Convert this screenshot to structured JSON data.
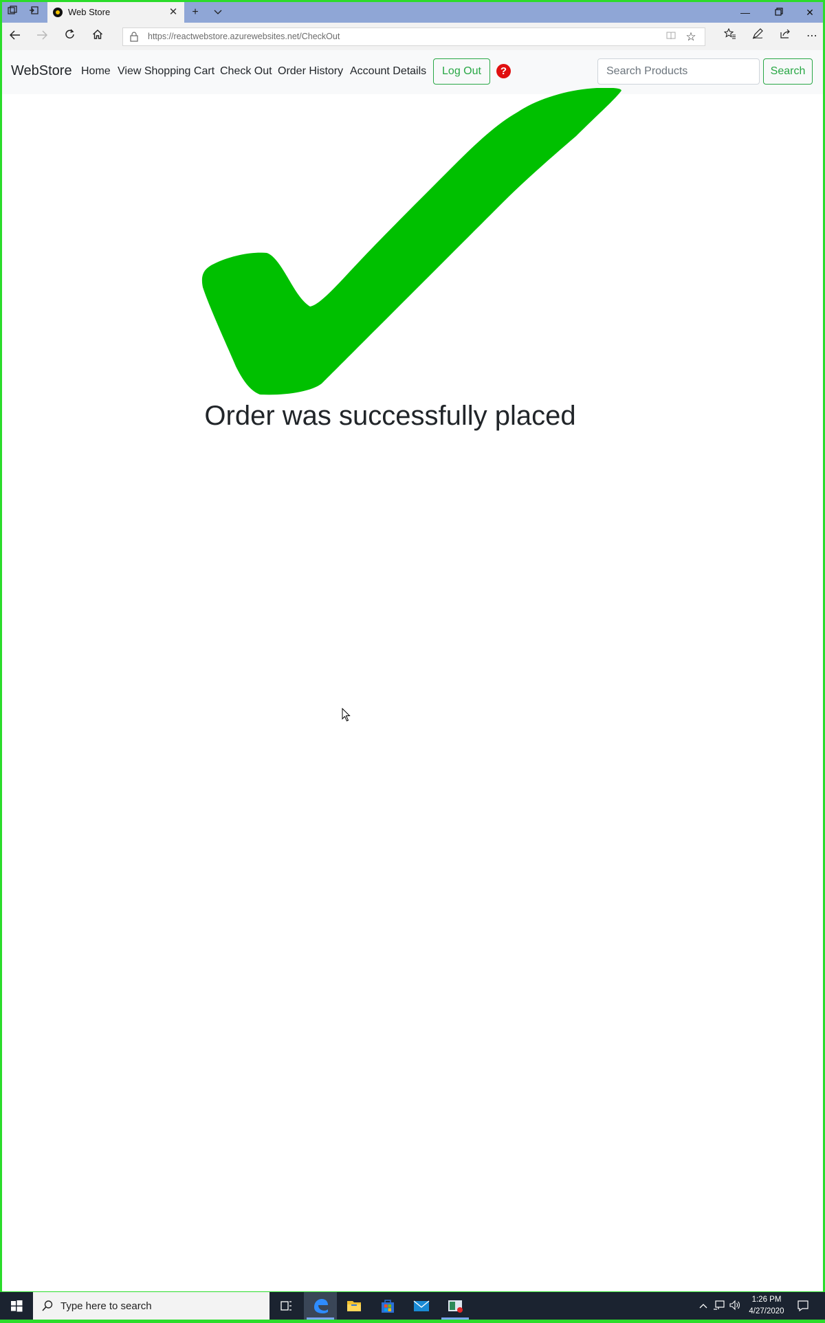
{
  "browser": {
    "tab_title": "Web Store",
    "url_host": "https://reactwebstore.azurewebsites.net",
    "url_path": "/CheckOut"
  },
  "site_nav": {
    "brand": "WebStore",
    "links": [
      "Home",
      "View Shopping Cart",
      "Check Out",
      "Order History",
      "Account Details"
    ],
    "logout_label": "Log Out",
    "help_label": "?",
    "search_placeholder": "Search Products",
    "search_button_label": "Search"
  },
  "content": {
    "success_message": "Order was successfully placed",
    "checkmark_color": "#00c000"
  },
  "taskbar": {
    "search_placeholder": "Type here to search",
    "time": "1:26 PM",
    "date": "4/27/2020"
  },
  "colors": {
    "accent_green": "#28a745",
    "help_red": "#e01010",
    "frame_green": "#2bdc2b"
  }
}
